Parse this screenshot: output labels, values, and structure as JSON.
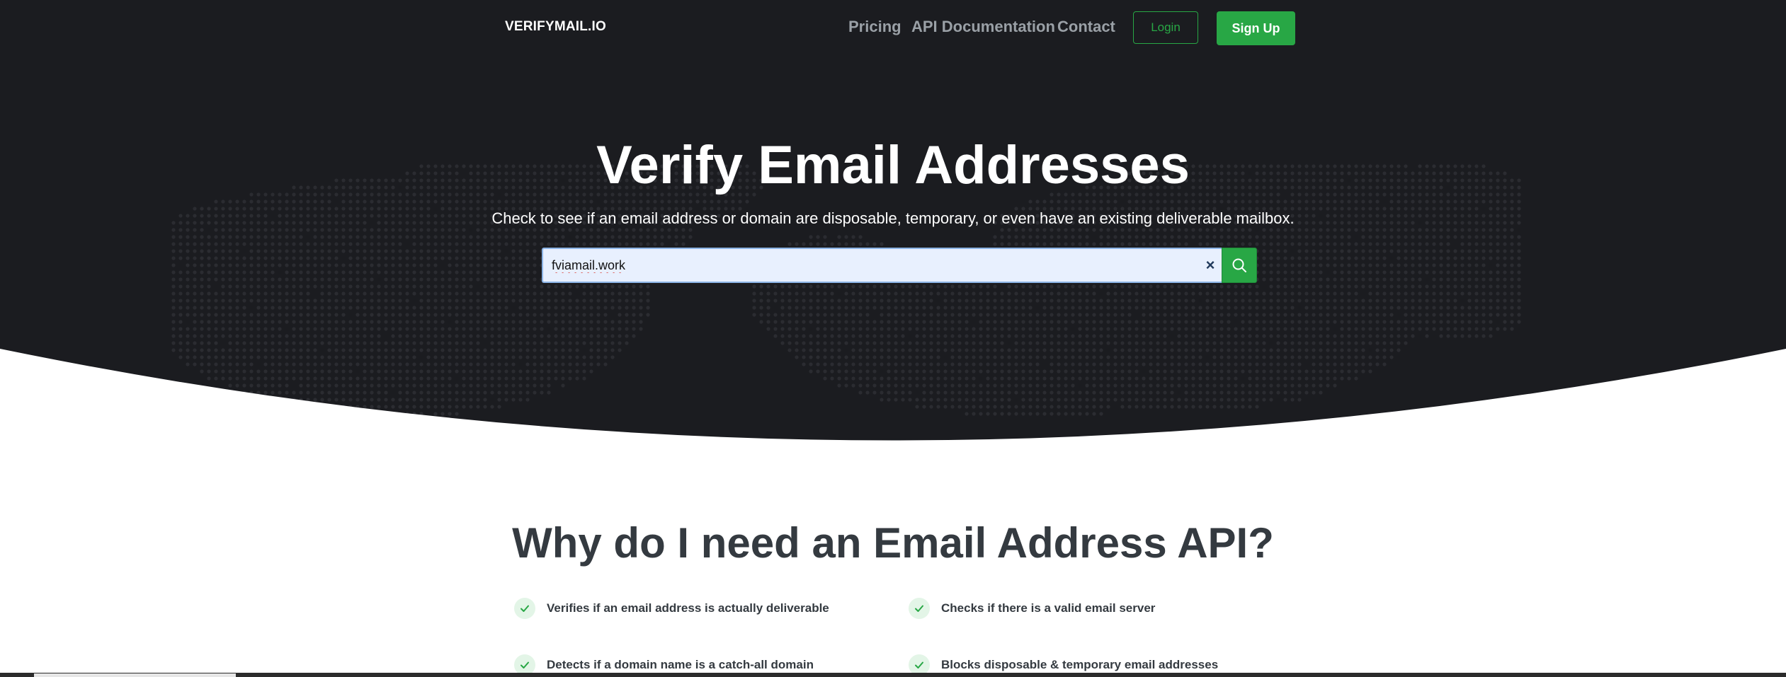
{
  "brand": {
    "name": "VERIFYMAIL.IO"
  },
  "nav": {
    "links": [
      "Pricing",
      "API Documentation",
      "Contact"
    ],
    "login_label": "Login",
    "signup_label": "Sign Up"
  },
  "hero": {
    "title": "Verify Email Addresses",
    "subtitle": "Check to see if an email address or domain are disposable, temporary, or even have an existing deliverable mailbox.",
    "search": {
      "value": "fviamail.work",
      "clear_icon": "close-icon",
      "button_icon": "search-icon"
    }
  },
  "why": {
    "title": "Why do I need an Email Address API?",
    "features": [
      "Verifies if an email address is actually deliverable",
      "Checks if there is a valid email server",
      "Detects if a domain name is a catch-all domain",
      "Blocks disposable & temporary email addresses"
    ]
  },
  "colors": {
    "hero_bg": "#1b1c20",
    "accent_green": "#28a745",
    "heading_dark": "#343a40"
  }
}
